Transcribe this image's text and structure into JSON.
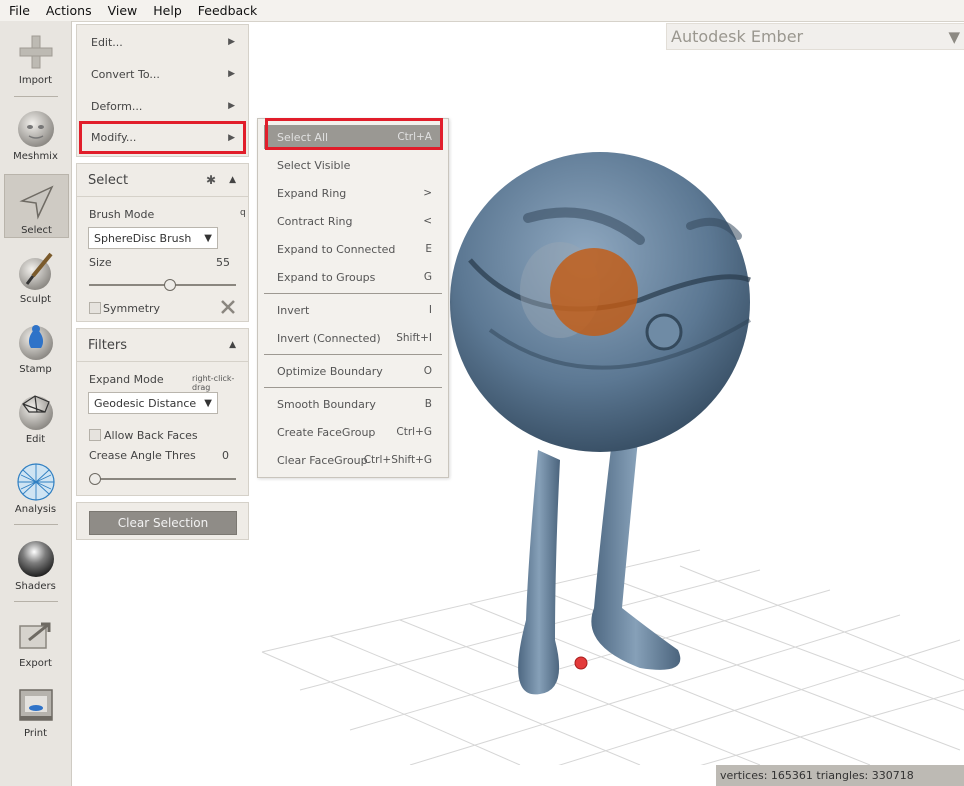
{
  "menubar": [
    "File",
    "Actions",
    "View",
    "Help",
    "Feedback"
  ],
  "toolbar": {
    "import": "Import",
    "meshmix": "Meshmix",
    "select": "Select",
    "sculpt": "Sculpt",
    "stamp": "Stamp",
    "edit": "Edit",
    "analysis": "Analysis",
    "shaders": "Shaders",
    "export": "Export",
    "print": "Print"
  },
  "action_menu": [
    {
      "label": "Edit...",
      "arrow": "▶"
    },
    {
      "label": "Convert To...",
      "arrow": "▶"
    },
    {
      "label": "Deform...",
      "arrow": "▶"
    },
    {
      "label": "Modify...",
      "arrow": "▶"
    }
  ],
  "select_panel": {
    "title": "Select",
    "brush_mode_label": "Brush Mode",
    "brush_mode_hotkey": "q",
    "brush_mode_value": "SphereDisc Brush",
    "size_label": "Size",
    "size_value": "55",
    "size_fraction": 0.55,
    "symmetry_label": "Symmetry"
  },
  "filters_panel": {
    "title": "Filters",
    "expand_mode_label": "Expand Mode",
    "expand_mode_hint": "right-click-drag",
    "expand_mode_value": "Geodesic Distance",
    "allow_back_faces_label": "Allow Back Faces",
    "crease_angle_label": "Crease Angle Thres",
    "crease_angle_value": "0",
    "crease_fraction": 0
  },
  "clear_selection_label": "Clear Selection",
  "modify_submenu": [
    {
      "label": "Select All",
      "key": "Ctrl+A"
    },
    {
      "label": "Select Visible",
      "key": ""
    },
    {
      "label": "Expand Ring",
      "key": ">"
    },
    {
      "label": "Contract Ring",
      "key": "<"
    },
    {
      "label": "Expand to Connected",
      "key": "E"
    },
    {
      "label": "Expand to Groups",
      "key": "G"
    },
    {
      "label": "Invert",
      "key": "I"
    },
    {
      "label": "Invert (Connected)",
      "key": "Shift+I"
    },
    {
      "label": "Optimize Boundary",
      "key": "O"
    },
    {
      "label": "Smooth Boundary",
      "key": "B"
    },
    {
      "label": "Create FaceGroup",
      "key": "Ctrl+G"
    },
    {
      "label": "Clear FaceGroup",
      "key": "Ctrl+Shift+G"
    }
  ],
  "brand": {
    "title": "Autodesk Ember",
    "arrow": "▼"
  },
  "status": "vertices: 165361 triangles: 330718",
  "colors": {
    "highlight": "#e11d2a",
    "model": "#5d7a96",
    "selection": "#c45a10"
  }
}
